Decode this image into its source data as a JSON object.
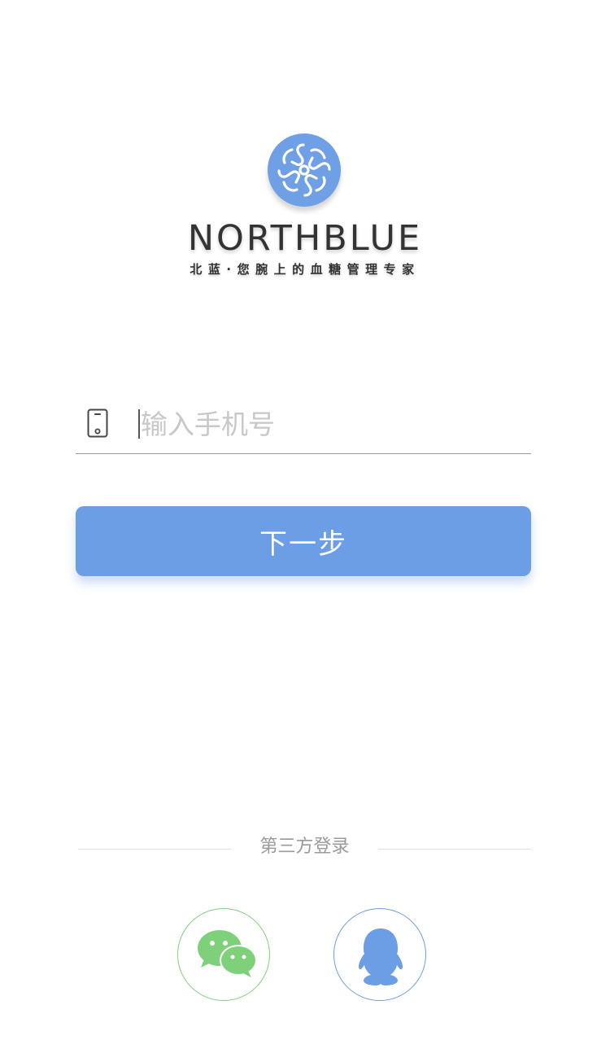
{
  "brand": {
    "name": "NORTHBLUE",
    "tagline": "北蓝·您腕上的血糖管理专家",
    "color": "#6f9fe4"
  },
  "login": {
    "phone_placeholder": "输入手机号",
    "phone_value": "",
    "phone_icon": "mobile-phone-icon",
    "next_label": "下一步",
    "button_color": "#6b9ee5"
  },
  "third_party": {
    "label": "第三方登录",
    "providers": [
      {
        "id": "wechat",
        "icon": "wechat-icon",
        "color": "#7fd07a"
      },
      {
        "id": "qq",
        "icon": "qq-penguin-icon",
        "color": "#6b9ee5"
      }
    ]
  }
}
